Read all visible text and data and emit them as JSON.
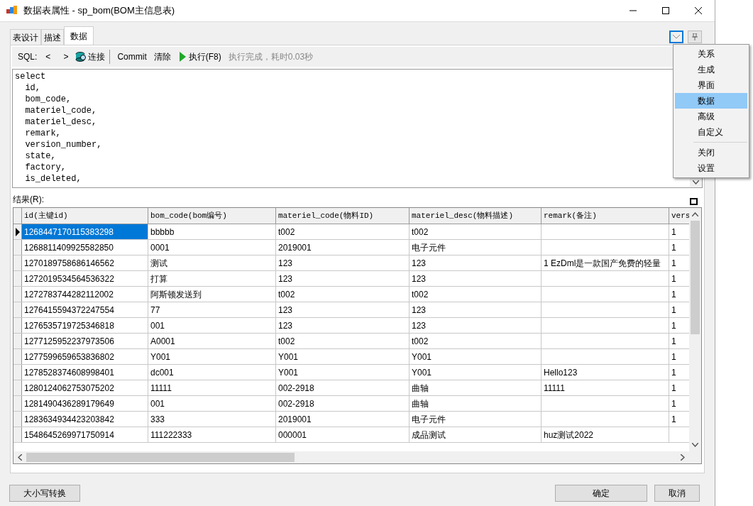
{
  "window": {
    "title": "数据表属性 - sp_bom(BOM主信息表)"
  },
  "tabs": [
    {
      "label": "表设计",
      "selected": false
    },
    {
      "label": "描述",
      "selected": false
    },
    {
      "label": "数据",
      "selected": true
    }
  ],
  "toolbar": {
    "sql_label": "SQL:",
    "prev": "<",
    "next": ">",
    "connect": "连接",
    "commit": "Commit",
    "clear": "清除",
    "run": "执行(F8)",
    "status": "执行完成，耗时0.03秒"
  },
  "sql_lines": [
    "select",
    "  id,",
    "  bom_code,",
    "  materiel_code,",
    "  materiel_desc,",
    "  remark,",
    "  version_number,",
    "  state,",
    "  factory,",
    "  is_deleted,"
  ],
  "result_label": "结果(R):",
  "table": {
    "columns": [
      "id(主键id)",
      "bom_code(bom编号)",
      "materiel_code(物料ID)",
      "materiel_desc(物料描述)",
      "remark(备注)",
      "vers"
    ],
    "rows": [
      {
        "selected": true,
        "cells": [
          "1268447170115383298",
          "bbbbb",
          "t002",
          "t002",
          "",
          "1"
        ]
      },
      {
        "selected": false,
        "cells": [
          "1268811409925582850",
          "0001",
          "2019001",
          "电子元件",
          "",
          "1"
        ]
      },
      {
        "selected": false,
        "cells": [
          "1270189758686146562",
          "测试",
          "123",
          "123",
          "1 EzDml是一款国产免费的轻量",
          "1"
        ]
      },
      {
        "selected": false,
        "cells": [
          "1272019534564536322",
          "打算",
          "123",
          "123",
          "",
          "1"
        ]
      },
      {
        "selected": false,
        "cells": [
          "1272783744282112002",
          "阿斯顿发送到",
          "t002",
          "t002",
          "",
          "1"
        ]
      },
      {
        "selected": false,
        "cells": [
          "1276415594372247554",
          "77",
          "123",
          "123",
          "",
          "1"
        ]
      },
      {
        "selected": false,
        "cells": [
          "1276535719725346818",
          "001",
          "123",
          "123",
          "",
          "1"
        ]
      },
      {
        "selected": false,
        "cells": [
          "1277125952237973506",
          "A0001",
          "t002",
          "t002",
          "",
          "1"
        ]
      },
      {
        "selected": false,
        "cells": [
          "1277599659653836802",
          "Y001",
          "Y001",
          "Y001",
          "",
          "1"
        ]
      },
      {
        "selected": false,
        "cells": [
          "1278528374608998401",
          "dc001",
          "Y001",
          "Y001",
          "Hello123",
          "1"
        ]
      },
      {
        "selected": false,
        "cells": [
          "1280124062753075202",
          "11111",
          "002-2918",
          "曲轴",
          "11111",
          "1"
        ]
      },
      {
        "selected": false,
        "cells": [
          "1281490436289179649",
          "001",
          "002-2918",
          "曲轴",
          "",
          "1"
        ]
      },
      {
        "selected": false,
        "cells": [
          "1283634934423203842",
          "333",
          "2019001",
          "电子元件",
          "",
          "1"
        ]
      },
      {
        "selected": false,
        "cells": [
          "1548645269971750914",
          "111222333",
          "000001",
          "成品测试",
          "huz测试2022",
          ""
        ]
      }
    ]
  },
  "menu": [
    {
      "kind": "item",
      "label": "关系",
      "selected": false
    },
    {
      "kind": "item",
      "label": "生成",
      "selected": false
    },
    {
      "kind": "item",
      "label": "界面",
      "selected": false
    },
    {
      "kind": "item",
      "label": "数据",
      "selected": true
    },
    {
      "kind": "item",
      "label": "高级",
      "selected": false
    },
    {
      "kind": "item",
      "label": "自定义",
      "selected": false
    },
    {
      "kind": "separator"
    },
    {
      "kind": "item",
      "label": "关闭",
      "selected": false
    },
    {
      "kind": "item",
      "label": "设置",
      "selected": false
    }
  ],
  "buttons": {
    "case": "大小写转换",
    "ok": "确定",
    "cancel": "取消"
  }
}
